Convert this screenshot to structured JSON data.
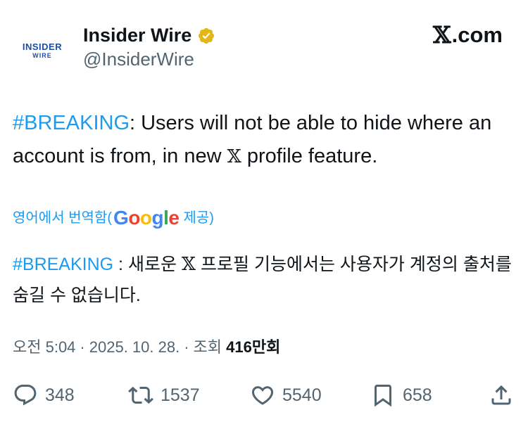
{
  "author": {
    "avatar_line1": "INSIDER",
    "avatar_line2": "WIRE",
    "name": "Insider Wire",
    "handle": "@InsiderWire",
    "verified_icon": "verified-gold-badge-icon"
  },
  "brand": {
    "symbol": "𝕏",
    "text": ".com"
  },
  "tweet": {
    "hashtag": "#BREAKING",
    "text_part1": ": Users will not be able to hide where an account is from, in new ",
    "x_symbol": "𝕏",
    "text_part2": " profile feature."
  },
  "translation": {
    "label_prefix": "영어에서 번역함(",
    "google_letters": [
      "G",
      "o",
      "o",
      "g",
      "l",
      "e"
    ],
    "label_suffix": "제공)",
    "hashtag": "#BREAKING",
    "text_part1": " : 새로운 ",
    "x_symbol": "𝕏",
    "text_part2": " 프로필 기능에서는 사용자가 계정의 출처를 숨길 수 없습니다."
  },
  "meta": {
    "time": "오전 5:04",
    "date": "2025. 10. 28.",
    "separator": "·",
    "views_label": "조회",
    "views_count": "416",
    "views_unit": "만회"
  },
  "actions": {
    "reply_count": "348",
    "retweet_count": "1537",
    "like_count": "5540",
    "bookmark_count": "658"
  },
  "colors": {
    "link": "#1d9bf0",
    "muted": "#536471",
    "text": "#0f1419",
    "verified": "#e2b719"
  }
}
